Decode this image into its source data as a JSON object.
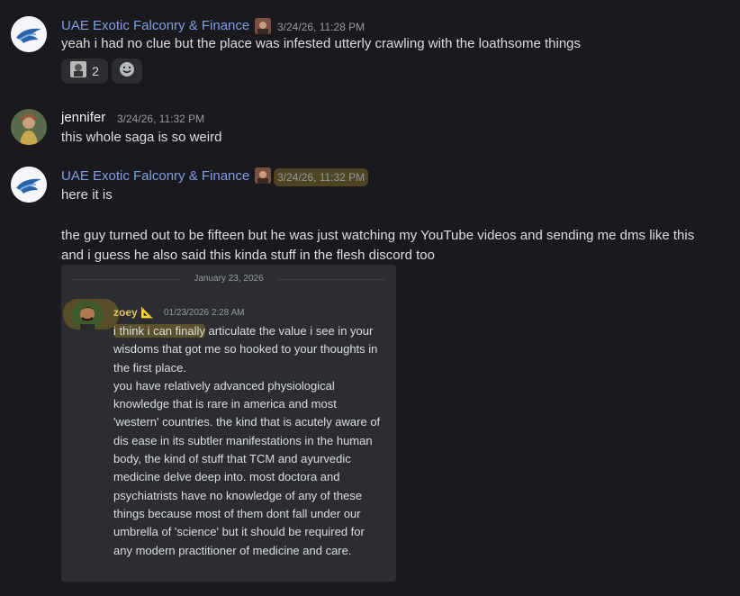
{
  "messages": [
    {
      "author": "UAE Exotic Falconry & Finance",
      "timestamp": "3/24/26, 11:28 PM",
      "text": "yeah i had no clue but the place was infested utterly crawling with the loathsome things",
      "reactions": [
        {
          "icon": "user-sticker-icon",
          "count": "2"
        },
        {
          "icon": "add-reaction-icon"
        }
      ]
    },
    {
      "author": "jennifer",
      "timestamp": "3/24/26, 11:32 PM",
      "text": "this whole saga is so weird"
    },
    {
      "author": "UAE Exotic Falconry & Finance",
      "timestamp": "3/24/26, 11:32 PM",
      "lines": [
        "here it is",
        "the guy turned out to be fifteen but he was just watching my YouTube videos and sending me dms like this",
        "and i guess he also said this kinda stuff in the flesh discord too"
      ],
      "embed": {
        "date_divider": "January 23, 2026",
        "author": "zoey",
        "author_badge": "📐",
        "timestamp": "01/23/2026 2:28 AM",
        "highlight": "i think i can finally",
        "body_rest": " articulate the value i see in your wisdoms that got me so hooked to your thoughts in the first place.\nyou have relatively advanced physiological knowledge that is rare in america and most 'western' countries. the kind that is acutely aware of dis ease in its subtler manifestations in the human body, the kind of stuff that TCM and ayurvedic medicine delve deep into. most doctora and psychiatrists have no knowledge of any of these things because most of them dont fall under our umbrella of 'science' but it should be required for any modern practitioner of medicine and care."
      }
    }
  ],
  "colors": {
    "background": "#1a1a1e",
    "username_blue": "#7e9ee6",
    "highlight": "#b4962866"
  }
}
